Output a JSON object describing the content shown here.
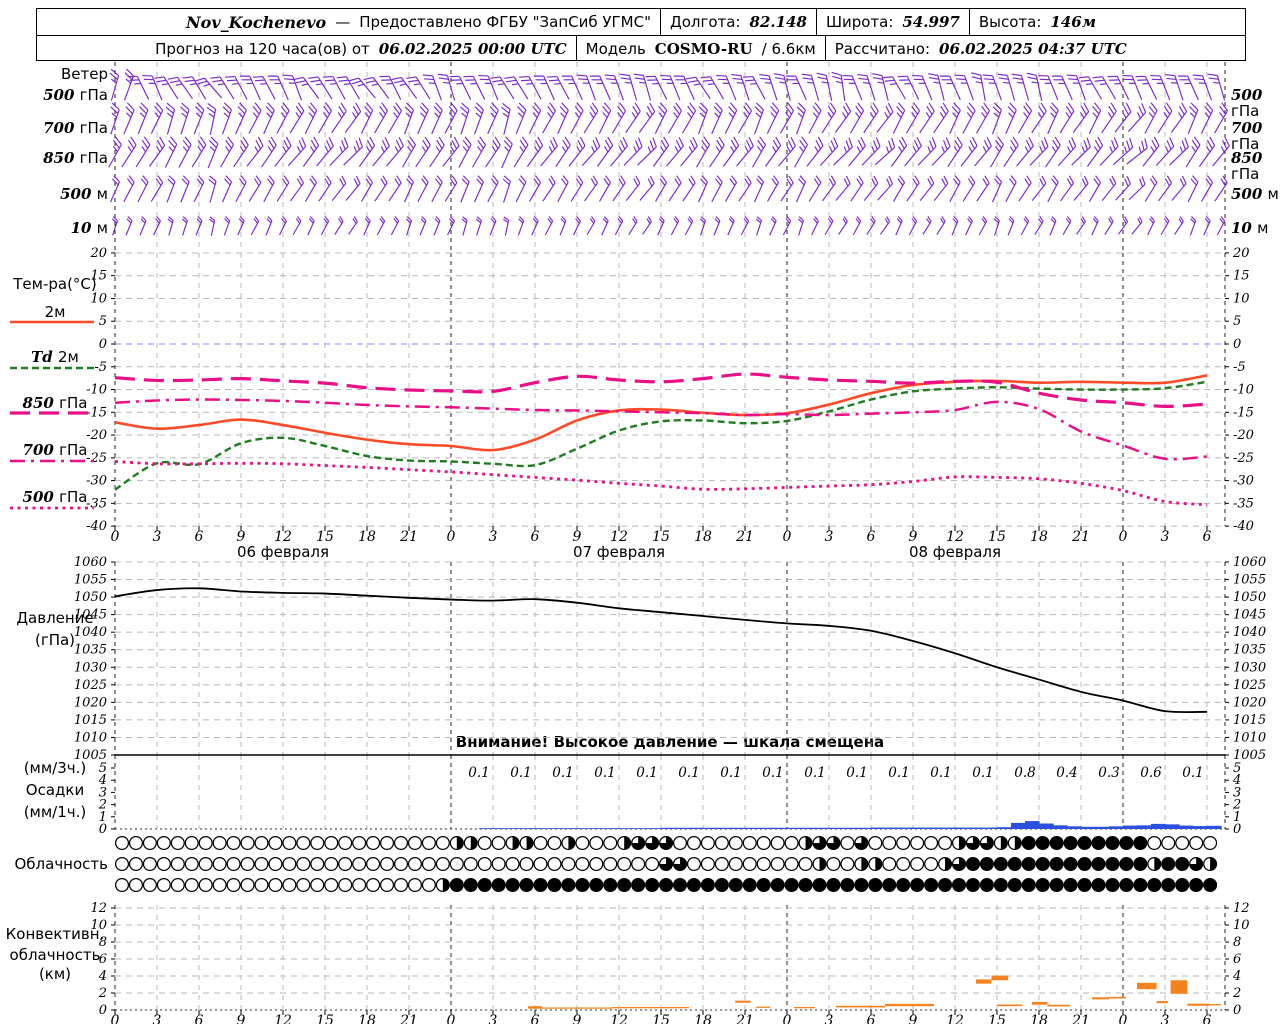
{
  "header": {
    "line1": {
      "station": "Nov_Kochenevo",
      "dash": "—",
      "provider": "Предоставлено ФГБУ \"ЗапСиб УГМС\"",
      "lon_label": "Долгота:",
      "lon": "82.148",
      "lat_label": "Широта:",
      "lat": "54.997",
      "alt_label": "Высота:",
      "alt": "146м"
    },
    "line2": {
      "prefix": "Прогноз на 120 часа(ов) от",
      "run_time": "06.02.2025 00:00 UTC",
      "model_label": "Модель",
      "model": "COSMO-RU",
      "resolution": "/ 6.6км",
      "calc_label": "Рассчитано:",
      "calc_time": "06.02.2025 04:37 UTC"
    }
  },
  "panels": {
    "wind": {
      "title": "Ветер"
    },
    "temperature": {
      "title": "Тем-ра(°C)",
      "legend": [
        {
          "num": "",
          "unit": "2м",
          "style": "t2m"
        },
        {
          "num": "Td",
          "unit": "2м",
          "style": "td2m"
        },
        {
          "num": "850",
          "unit": "гПа",
          "style": "t850"
        },
        {
          "num": "700",
          "unit": "гПа",
          "style": "t700"
        },
        {
          "num": "500",
          "unit": "гПа",
          "style": "t500"
        }
      ]
    },
    "pressure": {
      "title1": "Давление",
      "title2": "(гПа)"
    },
    "precip": {
      "title1": "(мм/3ч.)",
      "title2": "Осадки",
      "title3": "(мм/1ч.)"
    },
    "cloud": {
      "title": "Облачность"
    },
    "conv": {
      "title1": "Конвективн.",
      "title2": "облачность",
      "title3": "(км)"
    },
    "warning": "Внимание! Высокое давление — шкала смещена"
  },
  "chart_data": {
    "type": "meteogram",
    "hours": [
      0,
      3,
      6,
      9,
      12,
      15,
      18,
      21,
      24,
      27,
      30,
      33,
      36,
      39,
      42,
      45,
      48,
      51,
      54,
      57,
      60,
      63,
      66,
      69,
      72,
      75,
      78
    ],
    "axis": {
      "temp_ticks": [
        "20",
        "15",
        "10",
        "5",
        "0",
        "-5",
        "-10",
        "-15",
        "-20",
        "-25",
        "-30",
        "-35",
        "-40"
      ],
      "pressure_ticks": [
        "1060",
        "1055",
        "1050",
        "1045",
        "1040",
        "1035",
        "1030",
        "1025",
        "1020",
        "1015",
        "1010",
        "1005"
      ],
      "precip_ticks": [
        "5",
        "4",
        "3",
        "2",
        "1",
        "0"
      ],
      "conv_ticks": [
        "12",
        "10",
        "8",
        "6",
        "4",
        "2",
        "0"
      ],
      "hour_labels": [
        "0",
        "3",
        "6",
        "9",
        "12",
        "15",
        "18",
        "21",
        "0",
        "3",
        "6",
        "9",
        "12",
        "15",
        "18",
        "21",
        "0",
        "3",
        "6",
        "9",
        "12",
        "15",
        "18",
        "21",
        "0",
        "3",
        "6"
      ],
      "dates": [
        {
          "text": "06 февраля",
          "hour": 12
        },
        {
          "text": "07 февраля",
          "hour": 36
        },
        {
          "text": "08 февраля",
          "hour": 60
        }
      ]
    },
    "temperature": {
      "unit": "°C",
      "ylim": [
        -40,
        20
      ],
      "series": [
        {
          "name": "2м",
          "style": "t2m",
          "color": "#ff4a28",
          "values": [
            -17.2,
            -18.6,
            -17.8,
            -16.6,
            -17.8,
            -19.5,
            -21.0,
            -22.0,
            -22.4,
            -23.3,
            -21.0,
            -16.8,
            -14.6,
            -14.4,
            -15.1,
            -15.6,
            -15.2,
            -13.3,
            -10.8,
            -9.0,
            -8.3,
            -8.1,
            -8.5,
            -8.3,
            -8.5,
            -8.5,
            -6.9
          ]
        },
        {
          "name": "Td 2м",
          "style": "td2m",
          "color": "#1e7d1e",
          "values": [
            -32.0,
            -26.2,
            -26.4,
            -21.8,
            -20.6,
            -22.4,
            -24.6,
            -25.6,
            -25.8,
            -26.3,
            -26.6,
            -23.0,
            -19.0,
            -17.0,
            -16.8,
            -17.4,
            -16.9,
            -14.8,
            -12.2,
            -10.4,
            -9.8,
            -9.5,
            -9.8,
            -10.0,
            -10.0,
            -9.7,
            -8.3
          ]
        },
        {
          "name": "850 гПа",
          "style": "t850",
          "color": "#ea0f87",
          "values": [
            -7.4,
            -8.0,
            -7.9,
            -7.6,
            -8.1,
            -8.6,
            -9.6,
            -10.1,
            -10.3,
            -10.4,
            -8.5,
            -7.1,
            -7.9,
            -8.3,
            -7.6,
            -6.6,
            -7.3,
            -7.9,
            -8.2,
            -8.6,
            -8.2,
            -8.4,
            -10.8,
            -12.3,
            -12.9,
            -13.7,
            -13.2
          ]
        },
        {
          "name": "700 гПа",
          "style": "t700",
          "color": "#ea0f87",
          "values": [
            -12.9,
            -12.4,
            -12.2,
            -12.3,
            -12.5,
            -12.9,
            -13.4,
            -13.7,
            -13.9,
            -14.2,
            -14.5,
            -14.6,
            -14.8,
            -15.0,
            -15.2,
            -15.6,
            -15.4,
            -15.6,
            -15.3,
            -15.0,
            -14.5,
            -12.7,
            -14.3,
            -19.2,
            -22.3,
            -25.2,
            -24.7
          ]
        },
        {
          "name": "500 гПа",
          "style": "t500",
          "color": "#ea0f87",
          "values": [
            -25.8,
            -26.3,
            -26.3,
            -26.2,
            -26.3,
            -26.7,
            -27.1,
            -27.6,
            -28.1,
            -28.7,
            -29.3,
            -29.9,
            -30.6,
            -31.2,
            -31.9,
            -31.8,
            -31.5,
            -31.2,
            -30.9,
            -30.2,
            -29.2,
            -29.3,
            -29.6,
            -30.6,
            -32.2,
            -34.6,
            -35.3
          ]
        }
      ]
    },
    "pressure": {
      "unit": "гПа",
      "ylim": [
        1005,
        1060
      ],
      "values": [
        1050.2,
        1052.0,
        1052.5,
        1051.6,
        1051.2,
        1051.0,
        1050.4,
        1049.8,
        1049.3,
        1049.0,
        1049.4,
        1048.4,
        1046.8,
        1045.7,
        1044.6,
        1043.5,
        1042.5,
        1041.8,
        1040.4,
        1037.5,
        1034.0,
        1030.0,
        1026.5,
        1023.0,
        1020.5,
        1017.5,
        1017.3
      ]
    },
    "precipitation": {
      "unit_bars": "мм/1ч",
      "unit_labels": "мм/3ч",
      "ylim": [
        0,
        5
      ],
      "labels": {
        "start_hour": 26,
        "step": 3,
        "values": [
          "0.1",
          "0.1",
          "0.1",
          "0.1",
          "0.1",
          "0.1",
          "0.1",
          "0.1",
          "0.1",
          "0.1",
          "0.1",
          "0.1",
          "0.1",
          "0.8",
          "0.4",
          "0.3",
          "0.6",
          "0.1"
        ]
      },
      "hourly": [
        0,
        0,
        0,
        0,
        0,
        0,
        0,
        0,
        0,
        0,
        0,
        0,
        0,
        0,
        0,
        0,
        0,
        0,
        0,
        0,
        0,
        0,
        0,
        0,
        0,
        0,
        0.07,
        0.07,
        0.07,
        0.07,
        0.07,
        0.07,
        0.07,
        0.07,
        0.07,
        0.07,
        0.07,
        0.07,
        0.07,
        0.1,
        0.1,
        0.1,
        0.1,
        0.1,
        0.1,
        0.1,
        0.1,
        0.1,
        0.1,
        0.1,
        0.1,
        0.1,
        0.1,
        0.1,
        0.12,
        0.12,
        0.12,
        0.12,
        0.12,
        0.12,
        0.12,
        0.12,
        0.12,
        0.15,
        0.5,
        0.65,
        0.45,
        0.3,
        0.22,
        0.18,
        0.18,
        0.22,
        0.28,
        0.3,
        0.42,
        0.38,
        0.28,
        0.24,
        0.26
      ]
    },
    "cloudiness": {
      "fill_scale": "quarters 0-4",
      "rows": [
        "0000000000000000000000002200220020002333000000000233030000002332244444444400000",
        "0000000000000000000000000000000000000003300000000020022000023444444444444424432",
        "0000000000000000000000024444444444444444444444444444444444444444444444444444444"
      ]
    },
    "convective": {
      "unit": "км",
      "ylim": [
        0,
        12
      ],
      "segments": [
        [
          29.5,
          30.5,
          0.15,
          0.45
        ],
        [
          30.5,
          35.5,
          0.15,
          0.3
        ],
        [
          35.5,
          41,
          0.2,
          0.35
        ],
        [
          44.3,
          45.4,
          0.85,
          1.1
        ],
        [
          45.8,
          46.8,
          0.25,
          0.4
        ],
        [
          48.5,
          50,
          0.2,
          0.35
        ],
        [
          51.5,
          55,
          0.3,
          0.5
        ],
        [
          55,
          58.5,
          0.45,
          0.72
        ],
        [
          61.5,
          62.6,
          3.1,
          3.6
        ],
        [
          62.6,
          63.8,
          3.5,
          4.05
        ],
        [
          63,
          64.8,
          0.45,
          0.65
        ],
        [
          65.5,
          66.6,
          0.62,
          0.95
        ],
        [
          66.6,
          68.2,
          0.42,
          0.62
        ],
        [
          69.8,
          71,
          1.25,
          1.5
        ],
        [
          71,
          72.2,
          1.35,
          1.55
        ],
        [
          73,
          74.4,
          2.45,
          3.2
        ],
        [
          74.4,
          75.2,
          0.8,
          1.05
        ],
        [
          75.4,
          76.6,
          1.9,
          3.5
        ],
        [
          76.6,
          78.2,
          0.5,
          0.75
        ],
        [
          78.2,
          79,
          0.55,
          0.7
        ]
      ]
    },
    "wind": {
      "color": "#7d26c9",
      "rows": [
        {
          "value": "500",
          "unit": "гПа",
          "angles": [
            22,
            -28,
            -35,
            -30,
            -24,
            -30,
            -36,
            -30,
            -22,
            -26,
            -30,
            -24,
            -18,
            -22,
            -28,
            -24,
            -18,
            -14,
            -18,
            -24,
            -20,
            -14,
            -18,
            -24,
            -28,
            -22,
            -18
          ]
        },
        {
          "value": "700",
          "unit": "гПа",
          "angles": [
            25,
            20,
            18,
            22,
            28,
            32,
            30,
            26,
            22,
            20,
            24,
            28,
            32,
            30,
            26,
            24,
            26,
            30,
            34,
            32,
            28,
            26,
            28,
            32,
            36,
            32,
            28
          ]
        },
        {
          "value": "850",
          "unit": "гПа",
          "angles": [
            35,
            30,
            28,
            32,
            38,
            42,
            40,
            36,
            32,
            30,
            34,
            38,
            42,
            40,
            36,
            34,
            36,
            40,
            44,
            42,
            38,
            36,
            38,
            42,
            46,
            42,
            38
          ]
        },
        {
          "value": "500",
          "unit": "м",
          "angles": [
            30,
            25,
            22,
            26,
            32,
            36,
            34,
            30,
            26,
            24,
            28,
            32,
            36,
            34,
            30,
            28,
            30,
            34,
            38,
            36,
            32,
            30,
            32,
            36,
            40,
            36,
            32
          ]
        },
        {
          "value": "10",
          "unit": "м",
          "angles": [
            24,
            20,
            18,
            22,
            26,
            30,
            28,
            24,
            20,
            18,
            22,
            26,
            30,
            28,
            24,
            22,
            24,
            28,
            32,
            30,
            26,
            24,
            26,
            30,
            34,
            30,
            26
          ]
        }
      ]
    }
  }
}
